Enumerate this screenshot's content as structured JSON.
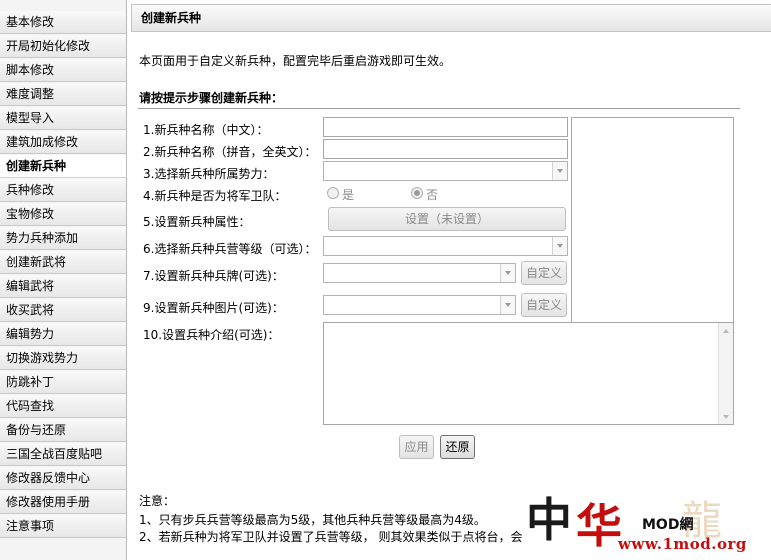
{
  "sidebar": {
    "items": [
      {
        "label": "基本修改"
      },
      {
        "label": "开局初始化修改"
      },
      {
        "label": "脚本修改"
      },
      {
        "label": "难度调整"
      },
      {
        "label": "模型导入"
      },
      {
        "label": "建筑加成修改"
      },
      {
        "label": "创建新兵种",
        "active": true
      },
      {
        "label": "兵种修改"
      },
      {
        "label": "宝物修改"
      },
      {
        "label": "势力兵种添加"
      },
      {
        "label": "创建新武将"
      },
      {
        "label": "编辑武将"
      },
      {
        "label": "收买武将"
      },
      {
        "label": "编辑势力"
      },
      {
        "label": "切换游戏势力"
      },
      {
        "label": "防跳补丁"
      },
      {
        "label": "代码查找"
      },
      {
        "label": "备份与还原"
      },
      {
        "label": "三国全战百度贴吧"
      },
      {
        "label": "修改器反馈中心"
      },
      {
        "label": "修改器使用手册"
      },
      {
        "label": "注意事项"
      }
    ]
  },
  "page": {
    "title": "创建新兵种",
    "intro": "本页面用于自定义新兵种，配置完毕后重启游戏即可生效。",
    "steps_heading": "请按提示步骤创建新兵种："
  },
  "form": {
    "step1_label": "1.新兵种名称（中文）：",
    "step1_value": "",
    "step2_label": "2.新兵种名称（拼音，全英文）：",
    "step2_value": "",
    "step3_label": "3.选择新兵种所属势力：",
    "step3_value": "",
    "step4_label": "4.新兵种是否为将军卫队：",
    "step4_option_yes": "是",
    "step4_option_no": "否",
    "step4_selected": "否",
    "step5_label": "5.设置新兵种属性：",
    "step5_button": "设置（未设置）",
    "step6_label": "6.选择新兵种兵营等级（可选）：",
    "step6_value": "",
    "step7_label": "7.设置新兵种兵牌(可选)：",
    "step7_value": "",
    "step7_button": "自定义",
    "step9_label": "9.设置新兵种图片(可选)：",
    "step9_value": "",
    "step9_button": "自定义",
    "step10_label": "10.设置兵种介绍(可选)：",
    "step10_value": ""
  },
  "actions": {
    "apply_label": "应用",
    "restore_label": "还原"
  },
  "notes": {
    "title": "注意：",
    "items": [
      "1、只有步兵兵营等级最高为5级，其他兵种兵营等级最高为4级。",
      "2、若新兵种为将军卫队并设置了兵营等级， 则其效果类似于点将台，会"
    ]
  },
  "watermark": {
    "char1": "中",
    "char2": "华",
    "mod_text": "MOD網",
    "site_text": "www.1mod.org"
  },
  "colors": {
    "accent_red": "#c40d0d",
    "sidebar_bg": "#f4f4f4",
    "disabled_text": "#8a8a8a"
  }
}
